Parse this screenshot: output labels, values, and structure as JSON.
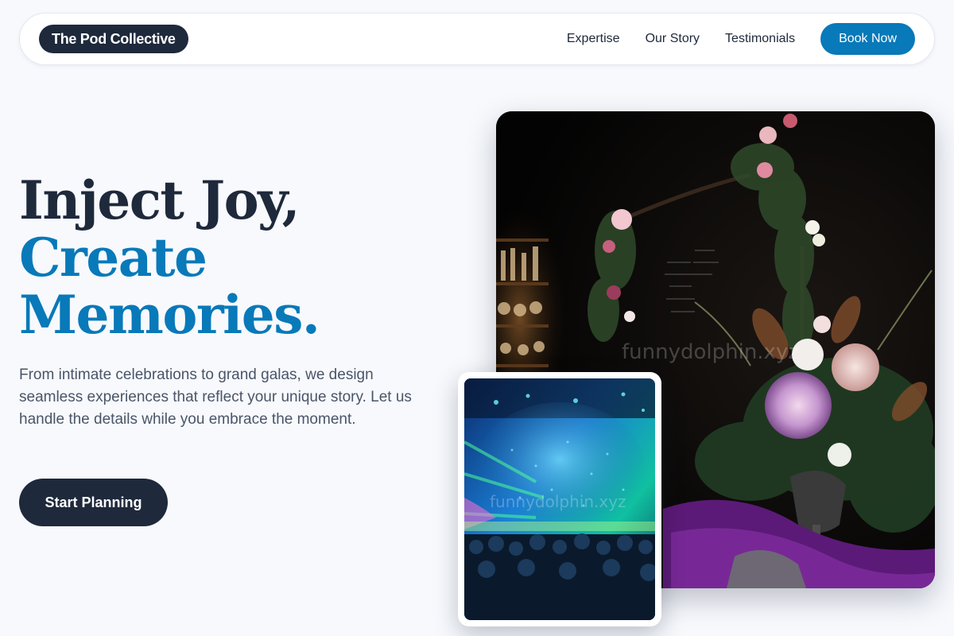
{
  "nav": {
    "logo": "The Pod Collective",
    "links": [
      "Expertise",
      "Our Story",
      "Testimonials"
    ],
    "cta": "Book Now"
  },
  "hero": {
    "title_line1": "Inject Joy,",
    "title_line2": "Create",
    "title_line3": "Memories.",
    "description": "From intimate celebrations to grand galas, we design seamless experiences that reflect your unique story. Let us handle the details while you embrace the moment.",
    "cta": "Start Planning"
  },
  "images": {
    "main_watermark": "funnydolphin.xyz",
    "secondary_watermark": "funnydolphin.xyz"
  },
  "colors": {
    "primary_dark": "#1e293b",
    "accent_blue": "#0879b9",
    "background": "#f7f9fd"
  }
}
